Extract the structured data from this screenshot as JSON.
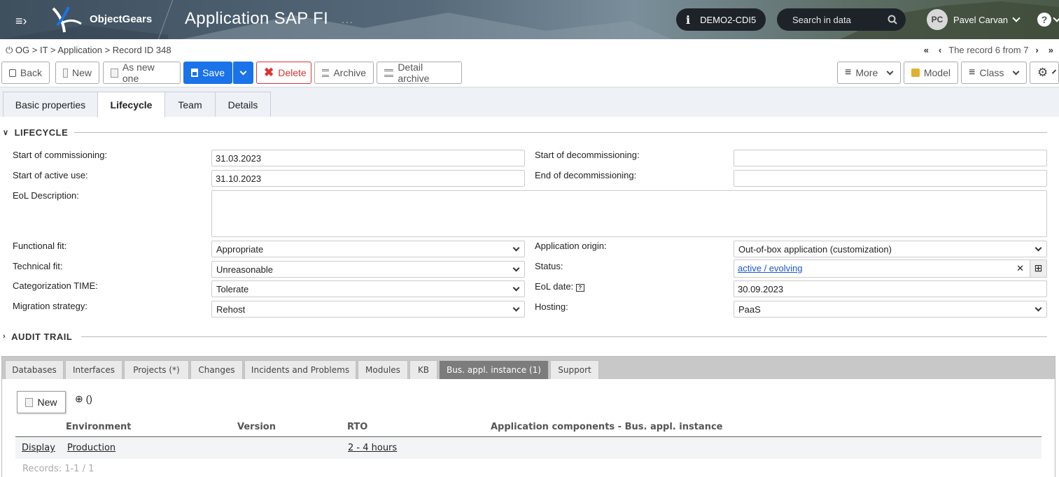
{
  "header": {
    "brand": "ObjectGears",
    "app_title": "Application SAP FI",
    "dots": "...",
    "database": "DEMO2-CDI5",
    "search_placeholder": "Search in data",
    "user_initials": "PC",
    "user_name": "Pavel Carvan",
    "help": "?"
  },
  "breadcrumb": "OG > IT > Application > Record ID 348",
  "record_nav": {
    "text": "The record 6 from 7"
  },
  "toolbar": {
    "back": "Back",
    "new": "New",
    "as_new": "As new one",
    "save": "Save",
    "delete": "Delete",
    "archive": "Archive",
    "detail_archive": "Detail archive",
    "more": "More",
    "model": "Model",
    "class": "Class"
  },
  "tabs": [
    "Basic properties",
    "Lifecycle",
    "Team",
    "Details"
  ],
  "active_tab": "Lifecycle",
  "lifecycle": {
    "title": "LIFECYCLE",
    "start_commissioning_label": "Start of commissioning:",
    "start_commissioning": "31.03.2023",
    "start_active_use_label": "Start of active use:",
    "start_active_use": "31.10.2023",
    "eol_desc_label": "EoL Description:",
    "eol_desc": "",
    "start_decom_label": "Start of decommissioning:",
    "start_decom": "",
    "end_decom_label": "End of decommissioning:",
    "end_decom": "",
    "functional_fit_label": "Functional fit:",
    "functional_fit": "Appropriate",
    "technical_fit_label": "Technical fit:",
    "technical_fit": "Unreasonable",
    "categorization_label": "Categorization TIME:",
    "categorization": "Tolerate",
    "migration_label": "Migration strategy:",
    "migration": "Rehost",
    "app_origin_label": "Application origin:",
    "app_origin": "Out-of-box application (customization)",
    "status_label": "Status:",
    "status": "active / evolving",
    "eol_date_label": "EoL date:",
    "eol_date": "30.09.2023",
    "hosting_label": "Hosting:",
    "hosting": "PaaS"
  },
  "audit_trail": {
    "title": "AUDIT TRAIL"
  },
  "subtabs": [
    "Databases",
    "Interfaces",
    "Projects (*)",
    "Changes",
    "Incidents and Problems",
    "Modules",
    "KB",
    "Bus. appl. instance (1)",
    "Support"
  ],
  "active_subtab": "Bus. appl. instance (1)",
  "grid": {
    "new_label": "New",
    "filter_text": "⊕ ()",
    "columns": [
      "Environment",
      "Version",
      "RTO",
      "Application components - Bus. appl. instance"
    ],
    "rows": [
      {
        "action": "Display",
        "environment": "Production",
        "version": "",
        "rto": "2 - 4 hours",
        "components": ""
      }
    ],
    "records": "Records: 1-1 / 1"
  },
  "colors": {
    "accent": "#1a73e8",
    "danger": "#d33333",
    "topbar": "#4b5d6c"
  }
}
